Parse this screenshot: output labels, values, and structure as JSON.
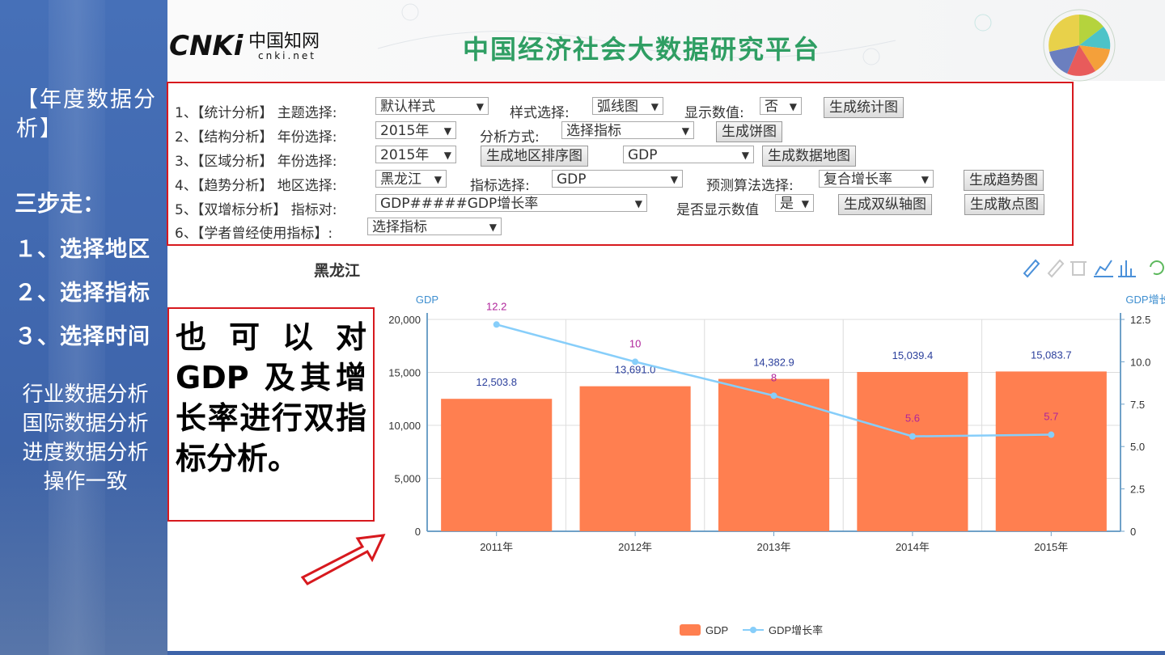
{
  "sidebar": {
    "year_title": "【年度数据分析】",
    "steps_title": "三步走：",
    "steps": [
      "１、选择地区",
      "２、选择指标",
      "３、选择时间"
    ],
    "other_lines": [
      "行业数据分析",
      "国际数据分析",
      "进度数据分析",
      "操作一致"
    ]
  },
  "header": {
    "logo_main": "CNKi",
    "logo_cn": "中国知网",
    "logo_sub": "cnki.net",
    "title": "中国经济社会大数据研究平台"
  },
  "controls": {
    "row1": {
      "label": "1、【统计分析】 主题选择:",
      "theme": "默认样式",
      "style_label": "样式选择:",
      "style": "弧线图",
      "show_label": "显示数值:",
      "show": "否",
      "button": "生成统计图"
    },
    "row2": {
      "label": "2、【结构分析】 年份选择:",
      "year": "2015年",
      "method_label": "分析方式:",
      "method": "选择指标",
      "button": "生成饼图"
    },
    "row3": {
      "label": "3、【区域分析】 年份选择:",
      "year": "2015年",
      "button1": "生成地区排序图",
      "indicator": "GDP",
      "button2": "生成数据地图"
    },
    "row4": {
      "label": "4、【趋势分析】 地区选择:",
      "region": "黑龙江",
      "ind_label": "指标选择:",
      "indicator": "GDP",
      "algo_label": "预测算法选择:",
      "algo": "复合增长率",
      "button": "生成趋势图"
    },
    "row5": {
      "label": "5、【双增标分析】 指标对:",
      "pair": "GDP#####GDP增长率",
      "show_label": "是否显示数值",
      "show": "是",
      "button1": "生成双纵轴图",
      "button2": "生成散点图"
    },
    "row6": {
      "label": "6、【学者曾经使用指标】:",
      "select": "选择指标"
    }
  },
  "callout": "也可以对 GDP 及其增长率进行双指标分析。",
  "colors": {
    "bar": "#ff7f50",
    "line": "#87cefa",
    "accent": "#d7191e",
    "title_green": "#2f9e63"
  },
  "chart_data": {
    "type": "bar",
    "title": "黑龙江",
    "categories": [
      "2011年",
      "2012年",
      "2013年",
      "2014年",
      "2015年"
    ],
    "series": [
      {
        "name": "GDP",
        "type": "bar",
        "axis": "left",
        "values": [
          12503.8,
          13691.0,
          14382.9,
          15039.4,
          15083.7
        ],
        "labels": [
          "12,503.8",
          "13,691.0",
          "14,382.9",
          "15,039.4",
          "15,083.7"
        ]
      },
      {
        "name": "GDP增长率",
        "type": "line",
        "axis": "right",
        "values": [
          12.2,
          10,
          8,
          5.6,
          5.7
        ],
        "labels": [
          "12.2",
          "10",
          "8",
          "5.6",
          "5.7"
        ]
      }
    ],
    "ylabel_left": "GDP",
    "ylabel_right": "GDP增长率",
    "ylim_left": [
      0,
      20000
    ],
    "ylim_right": [
      0,
      12.5
    ],
    "yticks_left": [
      "0",
      "5,000",
      "10,000",
      "15,000",
      "20,000"
    ],
    "yticks_right": [
      "0",
      "2.5",
      "5.0",
      "7.5",
      "10.0",
      "12.5"
    ],
    "grid": true,
    "legend_position": "bottom-center"
  }
}
